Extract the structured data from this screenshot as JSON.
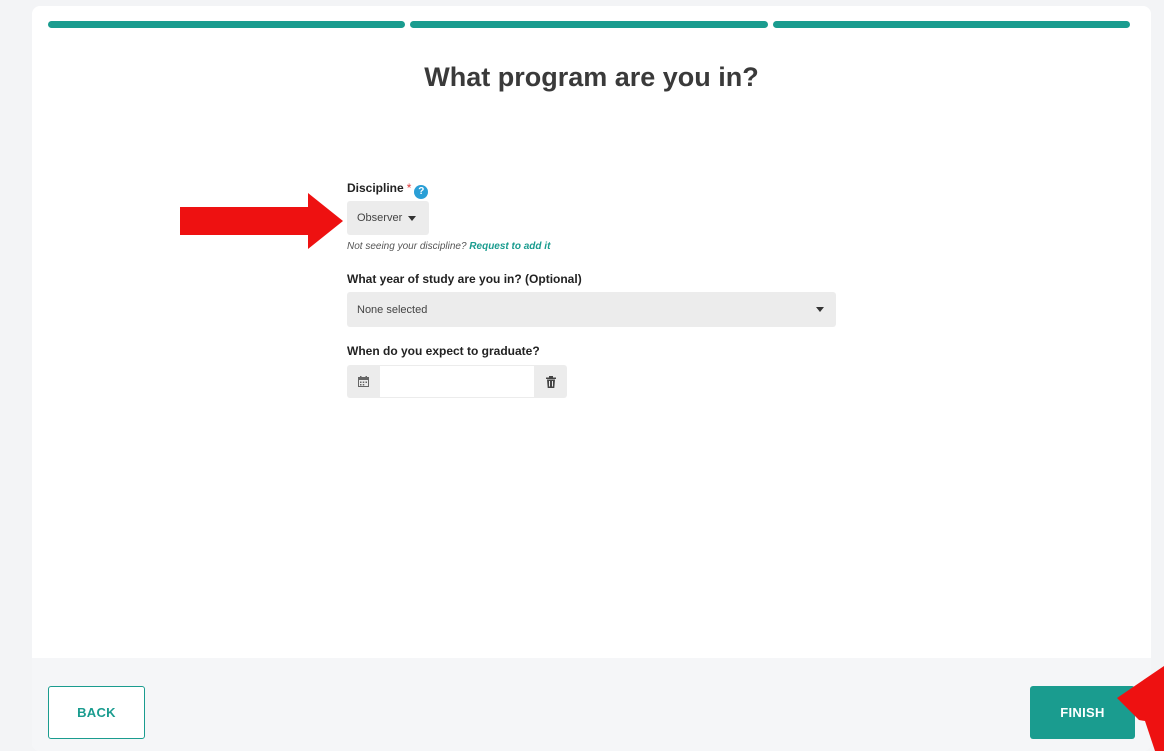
{
  "page": {
    "title": "What program are you in?"
  },
  "progress": {
    "steps_total": 3,
    "steps_completed": 3,
    "color": "#1a9c8f"
  },
  "discipline": {
    "label": "Discipline",
    "required_mark": "*",
    "help_icon": "?",
    "value": "Observer",
    "hint_text": "Not seeing your discipline?",
    "hint_link": "Request to add it"
  },
  "year_of_study": {
    "label": "What year of study are you in? (Optional)",
    "value": "None selected"
  },
  "graduation": {
    "label": "When do you expect to graduate?",
    "value": "",
    "calendar_icon": "calendar-icon",
    "clear_icon": "trash-icon"
  },
  "footer": {
    "back_label": "BACK",
    "finish_label": "FINISH"
  },
  "annotations": {
    "arrow_color": "#ee1111"
  }
}
